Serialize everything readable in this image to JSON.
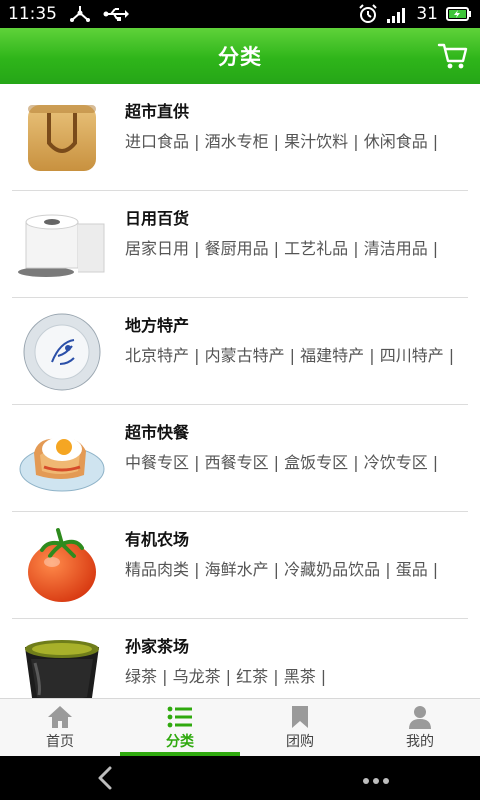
{
  "status_bar": {
    "time": "11:35",
    "battery": "31"
  },
  "header": {
    "title": "分类"
  },
  "categories": [
    {
      "name": "超市直供",
      "subs": "进口食品 | 酒水专柜 | 果汁饮料 | 休闲食品 |",
      "thumb": "shopping-bag-icon"
    },
    {
      "name": "日用百货",
      "subs": "居家日用 | 餐厨用品 | 工艺礼品 | 清洁用品 |",
      "thumb": "toilet-paper-icon"
    },
    {
      "name": "地方特产",
      "subs": "北京特产 | 内蒙古特产 | 福建特产 | 四川特产 |",
      "thumb": "porcelain-plate-icon"
    },
    {
      "name": "超市快餐",
      "subs": "中餐专区 | 西餐专区 | 盒饭专区 | 冷饮专区 |",
      "thumb": "fried-egg-toast-icon"
    },
    {
      "name": "有机农场",
      "subs": "精品肉类 | 海鲜水产 | 冷藏奶品饮品 | 蛋品 |",
      "thumb": "tomato-icon"
    },
    {
      "name": "孙家茶场",
      "subs": "绿茶 | 乌龙茶 | 红茶 | 黑茶 |",
      "thumb": "tea-cup-icon"
    }
  ],
  "tabs": [
    {
      "label": "首页",
      "icon": "home-icon",
      "active": false
    },
    {
      "label": "分类",
      "icon": "list-icon",
      "active": true
    },
    {
      "label": "团购",
      "icon": "bookmark-icon",
      "active": false
    },
    {
      "label": "我的",
      "icon": "user-icon",
      "active": false
    }
  ],
  "colors": {
    "accent": "#2fa90e",
    "header_top": "#5fd23a",
    "header_bottom": "#25a617"
  }
}
